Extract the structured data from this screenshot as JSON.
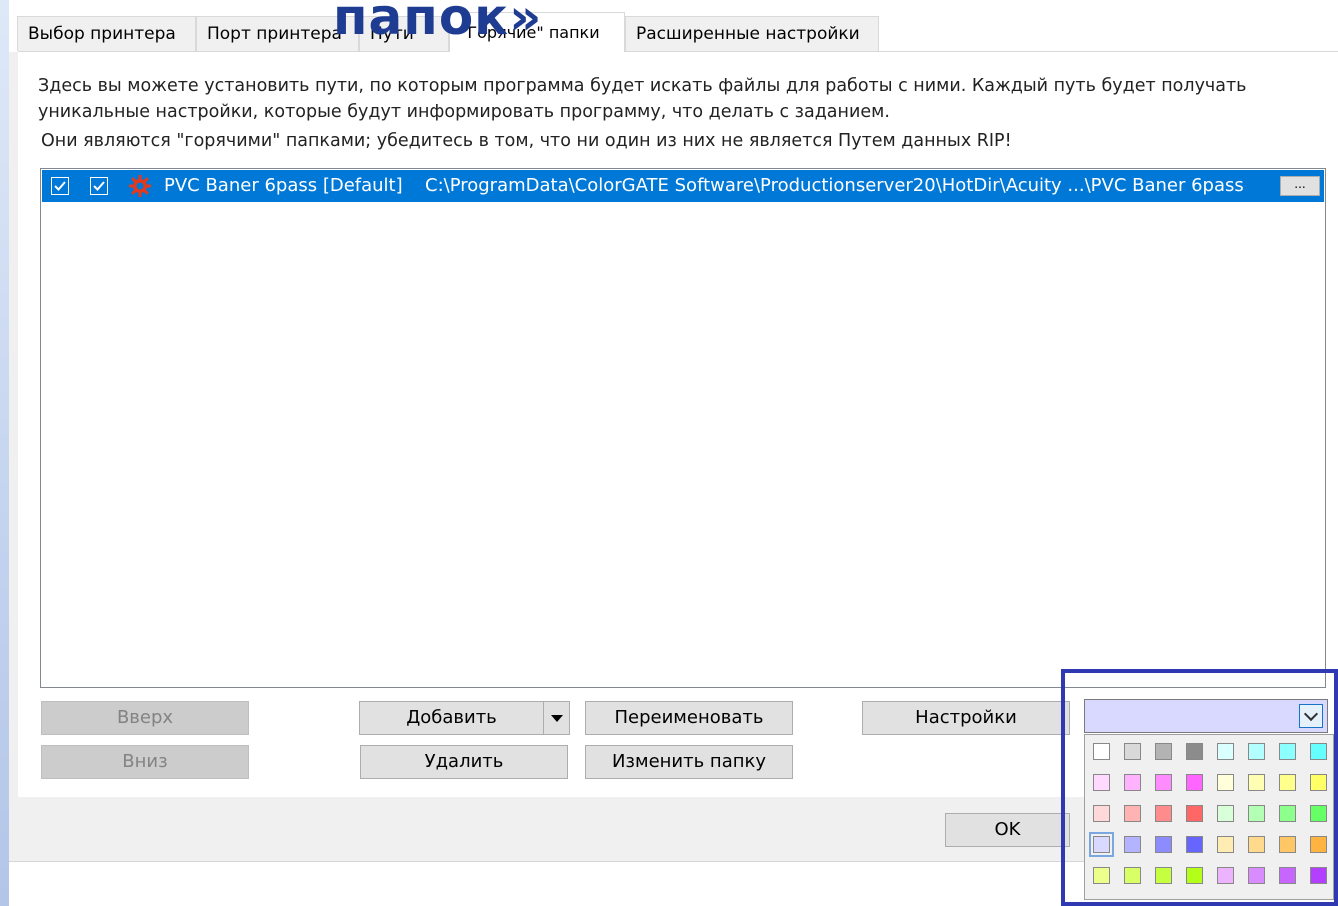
{
  "overlay_title": "папок»",
  "tabs": [
    {
      "label": "Выбор принтера"
    },
    {
      "label": "Порт принтера"
    },
    {
      "label": "Пути"
    },
    {
      "label": "\"Горячие\" папки"
    },
    {
      "label": "Расширенные настройки"
    }
  ],
  "description": {
    "line1": "Здесь вы можете установить пути, по которым программа будет искать файлы для работы с ними. Каждый путь будет получать",
    "line2": "уникальные настройки, которые будут информировать программу, что делать с заданием.",
    "line3": "Они являются \"горячими\" папками; убедитесь в том, что ни один из них не является Путем данных RIP!"
  },
  "hotfolders": [
    {
      "name": "PVC Baner 6pass [Default]",
      "path": "C:\\ProgramData\\ColorGATE Software\\Productionserver20\\HotDir\\Acuity ...\\PVC Baner 6pass",
      "checked1": true,
      "checked2": true,
      "browse_label": "..."
    }
  ],
  "buttons": {
    "up": "Вверх",
    "down": "Вниз",
    "add": "Добавить",
    "delete": "Удалить",
    "rename": "Переименовать",
    "change_folder": "Изменить папку",
    "settings": "Настройки",
    "ok": "OK"
  },
  "color_picker": {
    "selected_color": "#d9d9ff",
    "colors": [
      [
        "#ffffff",
        "#d9d9d9",
        "#b3b3b3",
        "#8c8c8c",
        "#d9ffff",
        "#b3ffff",
        "#8cffff",
        "#66ffff"
      ],
      [
        "#ffd9ff",
        "#ffb3ff",
        "#ff8cff",
        "#ff66ff",
        "#ffffd9",
        "#ffffb3",
        "#ffff8c",
        "#ffff66"
      ],
      [
        "#ffd9d9",
        "#ffb3b3",
        "#ff8c8c",
        "#ff6666",
        "#d9ffd9",
        "#b3ffb3",
        "#8cff8c",
        "#66ff66"
      ],
      [
        "#d9d9ff",
        "#b3b3ff",
        "#8c8cff",
        "#6666ff",
        "#ffecb3",
        "#ffd98c",
        "#ffc666",
        "#ffb340"
      ],
      [
        "#ecff8c",
        "#d9ff66",
        "#c6ff40",
        "#b3ff1a",
        "#ecb3ff",
        "#d98cff",
        "#c666ff",
        "#b340ff"
      ]
    ],
    "selected_index": [
      3,
      0
    ]
  }
}
